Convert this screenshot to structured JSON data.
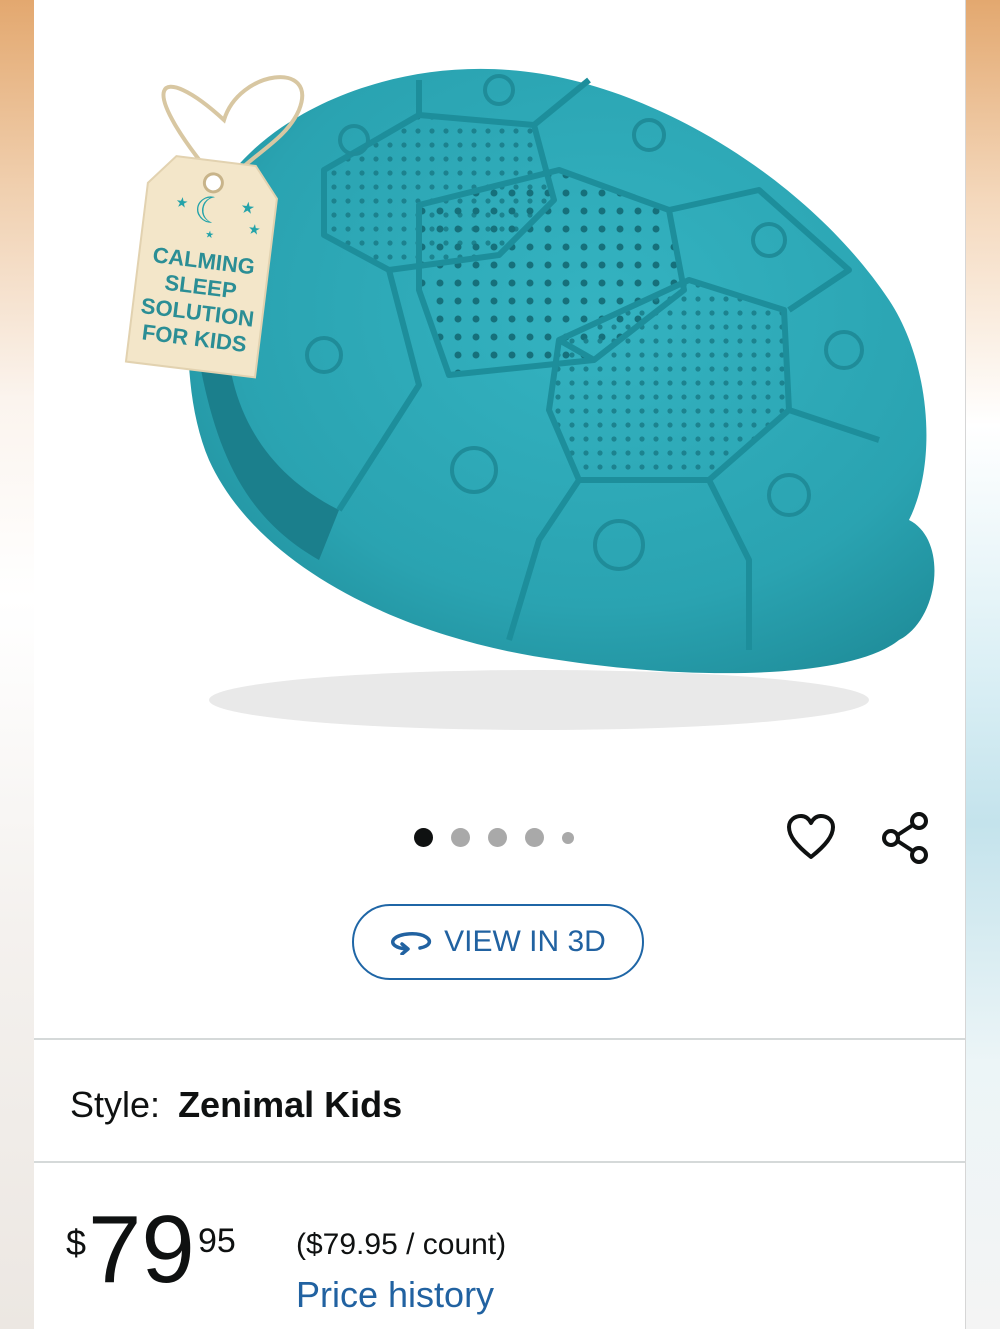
{
  "product_image": {
    "tag_lines": [
      "CALMING",
      "SLEEP",
      "SOLUTION",
      "FOR KIDS"
    ],
    "body_color": "#2aa3b1",
    "carousel_dot_count": 5,
    "active_dot": 1
  },
  "actions": {
    "view_3d_label": "VIEW IN 3D"
  },
  "style": {
    "label": "Style:",
    "value": "Zenimal Kids"
  },
  "price": {
    "currency": "$",
    "whole": "79",
    "fraction": "95",
    "unit_price": "($79.95 / count)",
    "history_link": "Price history"
  },
  "colors": {
    "link": "#2162a1",
    "text": "#0f1111",
    "divider": "#d5d9d9"
  }
}
